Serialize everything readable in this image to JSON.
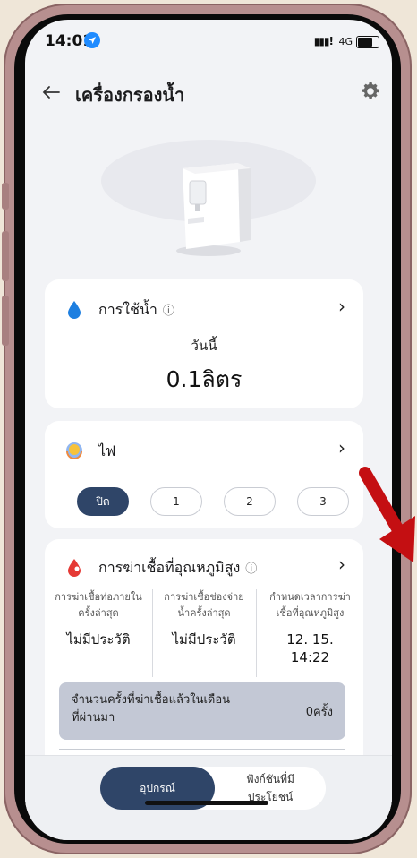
{
  "status": {
    "time": "14:01",
    "network": "4G"
  },
  "header": {
    "title": "เครื่องกรองน้ำ"
  },
  "usage_card": {
    "title": "การใช้น้ำ",
    "today_label": "วันนี้",
    "value": "0.1ลิตร"
  },
  "light_card": {
    "title": "ไฟ",
    "modes": [
      "ปิด",
      "1",
      "2",
      "3"
    ],
    "selected": "ปิด"
  },
  "sterilize_card": {
    "title": "การฆ่าเชื้อที่อุณหภูมิสูง",
    "columns": [
      {
        "header_line1": "การฆ่าเชื้อท่อภายใน",
        "header_line2": "ครั้งล่าสุด",
        "value_line1": "ไม่มีประวัติ",
        "value_line2": ""
      },
      {
        "header_line1": "การฆ่าเชื้อช่องจ่าย",
        "header_line2": "น้ำครั้งล่าสุด",
        "value_line1": "ไม่มีประวัติ",
        "value_line2": ""
      },
      {
        "header_line1": "กำหนดเวลาการฆ่า",
        "header_line2": "เชื้อที่อุณหภูมิสูง",
        "value_line1": "12. 15.",
        "value_line2": "14:22"
      }
    ],
    "count_label_line1": "จำนวนครั้งที่ฆ่าเชื้อแล้วในเดือน",
    "count_label_line2": "ที่ผ่านมา",
    "count_value": "0ครั้ง"
  },
  "bottom_nav": {
    "device": "อุปกรณ์",
    "useful_line1": "ฟังก์ชันที่มี",
    "useful_line2": "ประโยชน์"
  },
  "colors": {
    "accent": "#2f4568",
    "water_blue": "#1e7fe0",
    "sterilize_red": "#e53935",
    "annotation_red": "#c40f12"
  }
}
